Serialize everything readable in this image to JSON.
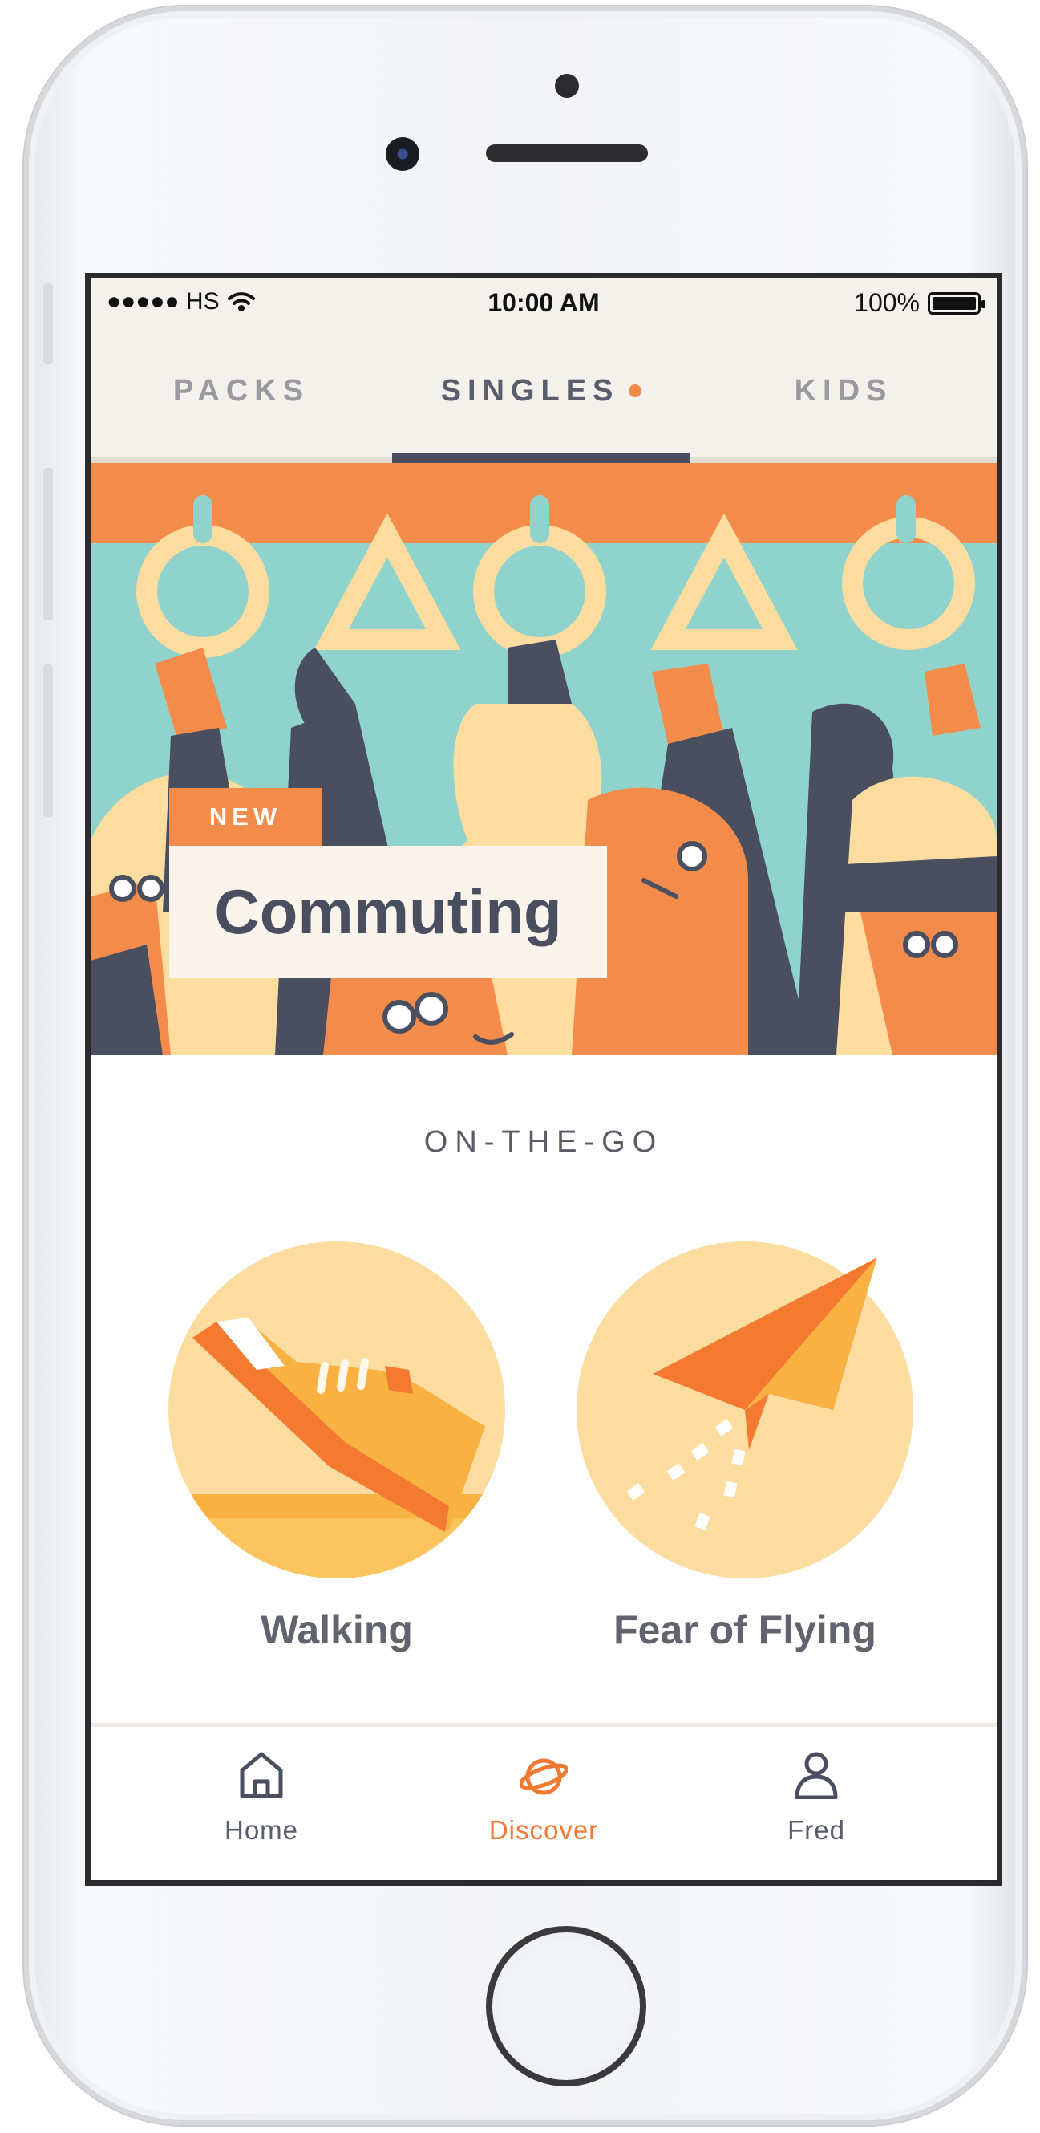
{
  "status_bar": {
    "carrier": "●●●●● HS",
    "time": "10:00 AM",
    "battery": "100%"
  },
  "tabs": [
    {
      "label": "PACKS",
      "active": false
    },
    {
      "label": "SINGLES",
      "active": true,
      "has_dot": true
    },
    {
      "label": "KIDS",
      "active": false
    }
  ],
  "hero": {
    "tag": "NEW",
    "title": "Commuting"
  },
  "section": {
    "title": "ON-THE-GO",
    "items": [
      {
        "label": "Walking",
        "icon": "shoe-icon"
      },
      {
        "label": "Fear of Flying",
        "icon": "paper-plane-icon"
      }
    ]
  },
  "bottom_nav": [
    {
      "label": "Home",
      "icon": "home-icon",
      "active": false
    },
    {
      "label": "Discover",
      "icon": "planet-icon",
      "active": true
    },
    {
      "label": "Fred",
      "icon": "profile-icon",
      "active": false
    }
  ],
  "colors": {
    "accent": "#f07a34",
    "navy": "#4a4f60",
    "teal": "#8fd3cc",
    "cream": "#fddca0",
    "tab_bg": "#f4f1ed"
  }
}
